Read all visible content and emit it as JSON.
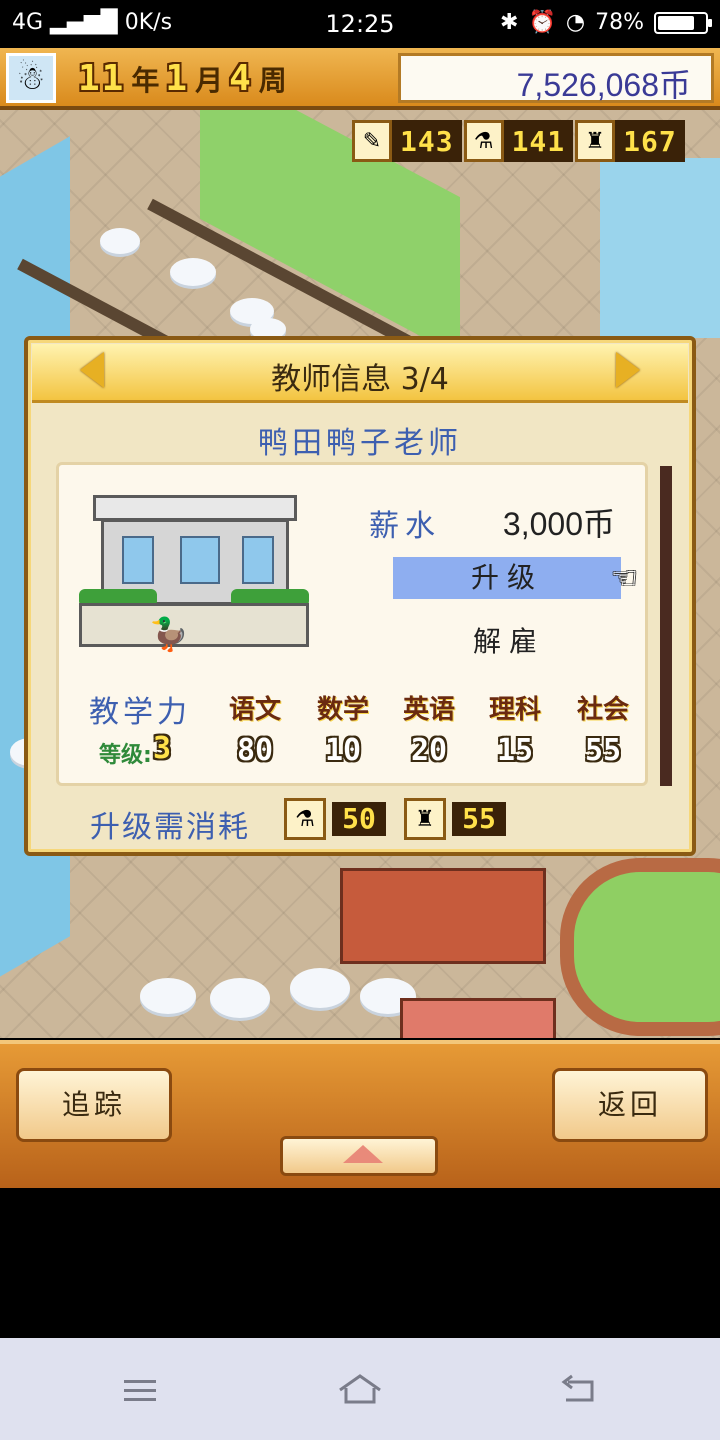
{
  "status_bar": {
    "network": "4G",
    "speed": "0K/s",
    "time": "12:25",
    "battery": "78%",
    "battery_level": 0.78
  },
  "top_bar": {
    "year": "11",
    "year_unit": "年",
    "month": "1",
    "month_unit": "月",
    "week": "4",
    "week_unit": "周",
    "money": "7,526,068币"
  },
  "resources": [
    {
      "icon": "pencil-icon",
      "value": "143"
    },
    {
      "icon": "flask-icon",
      "value": "141"
    },
    {
      "icon": "bell-icon",
      "value": "167"
    }
  ],
  "dialog": {
    "title": "教师信息 3/4",
    "teacher_name": "鸭田鸭子老师",
    "salary_label": "薪水",
    "salary_value": "3,000币",
    "upgrade_label": "升级",
    "fire_label": "解雇",
    "teaching_power_label": "教学力",
    "level_label": "等级:",
    "level_value": "3",
    "subjects": [
      {
        "name": "语文",
        "value": "80"
      },
      {
        "name": "数学",
        "value": "10"
      },
      {
        "name": "英语",
        "value": "20"
      },
      {
        "name": "理科",
        "value": "15"
      },
      {
        "name": "社会",
        "value": "55"
      }
    ],
    "cost_label": "升级需消耗",
    "costs": [
      {
        "icon": "flask-icon",
        "value": "50"
      },
      {
        "icon": "bell-icon",
        "value": "55"
      }
    ]
  },
  "bottom_bar": {
    "track_label": "追踪",
    "back_label": "返回"
  },
  "colors": {
    "accent_orange": "#d98a1c",
    "money_text": "#3a3a96",
    "label_blue": "#3d5fb0",
    "highlight_blue": "#8eaef0"
  }
}
